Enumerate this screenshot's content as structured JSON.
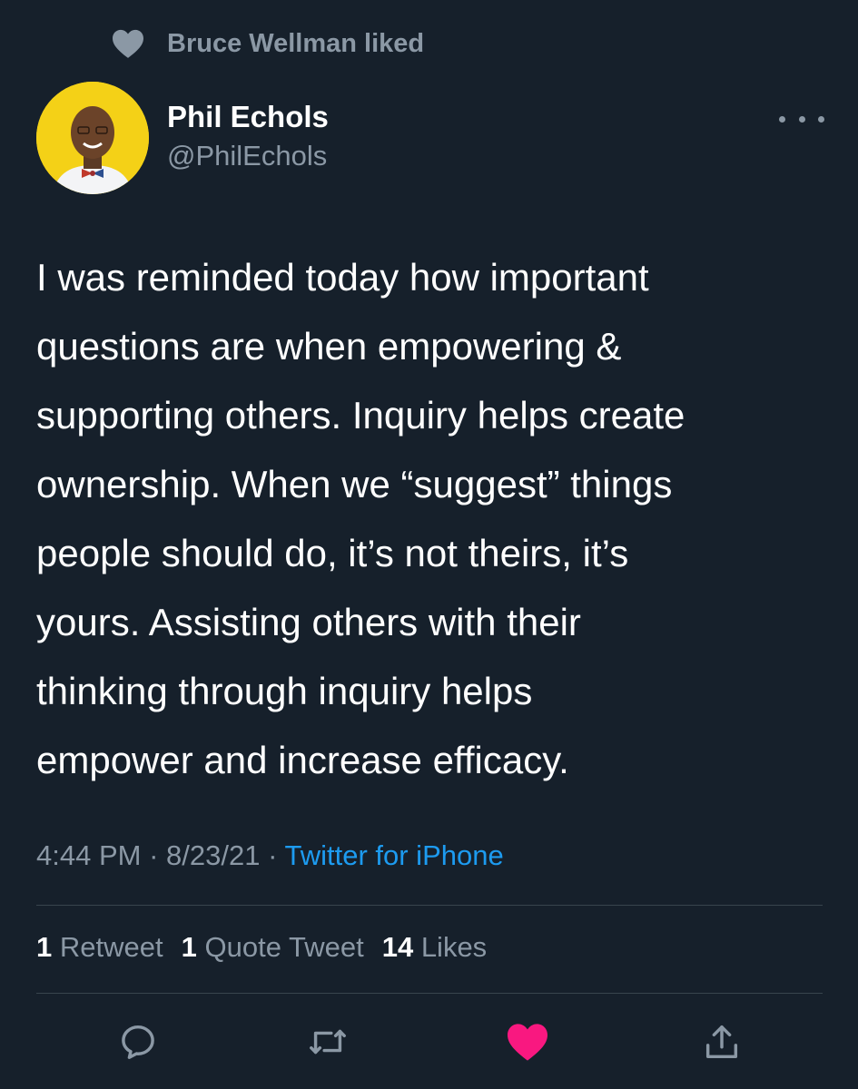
{
  "social_context": {
    "text": "Bruce Wellman liked",
    "icon": "heart-icon"
  },
  "author": {
    "name": "Phil Echols",
    "handle": "@PhilEchols",
    "avatar_bg": "#f4d117"
  },
  "more_icon": "more-horizontal-icon",
  "tweet": {
    "lines": [
      "I was reminded today how important",
      "questions are when empowering &",
      "supporting others. Inquiry helps create",
      "ownership. When we “suggest” things",
      "people should do, it’s not theirs, it’s",
      "yours. Assisting others with their",
      "thinking through inquiry helps",
      "empower and increase efficacy."
    ]
  },
  "meta": {
    "time": "4:44 PM",
    "date": "8/23/21",
    "separator": "·",
    "source": "Twitter for iPhone"
  },
  "stats": {
    "retweets_count": "1",
    "retweets_label": "Retweet",
    "quotes_count": "1",
    "quotes_label": "Quote Tweet",
    "likes_count": "14",
    "likes_label": "Likes"
  },
  "actions": [
    {
      "icon": "reply-icon"
    },
    {
      "icon": "retweet-icon"
    },
    {
      "icon": "like-icon-filled",
      "color": "#f91880"
    },
    {
      "icon": "share-icon"
    }
  ],
  "colors": {
    "background": "#16202b",
    "text": "#ffffff",
    "muted": "#8b98a5",
    "link": "#1d9bf0",
    "like": "#f91880",
    "divider": "#38444d"
  }
}
